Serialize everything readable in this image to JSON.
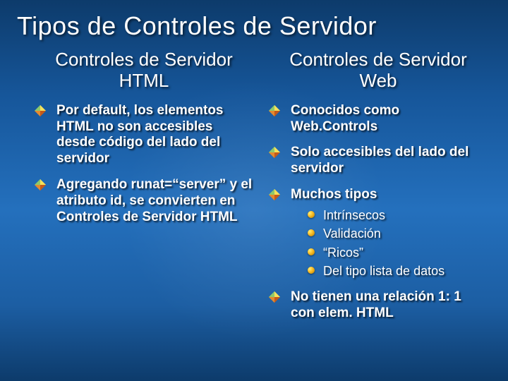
{
  "title": "Tipos de Controles de Servidor",
  "left": {
    "heading": "Controles de Servidor HTML",
    "items": [
      {
        "text": "Por default, los elementos HTML no son accesibles desde código del lado del servidor"
      },
      {
        "text": "Agregando runat=“server” y el atributo id, se convierten en Controles de Servidor HTML"
      }
    ]
  },
  "right": {
    "heading": "Controles de Servidor Web",
    "items": [
      {
        "text": "Conocidos como Web.Controls"
      },
      {
        "text": "Solo accesibles del lado del servidor"
      },
      {
        "text": "Muchos tipos",
        "sub": [
          "Intrínsecos",
          "Validación",
          "“Ricos”",
          "Del tipo lista de datos"
        ]
      },
      {
        "text": "No tienen una relación 1: 1 con elem. HTML"
      }
    ]
  }
}
